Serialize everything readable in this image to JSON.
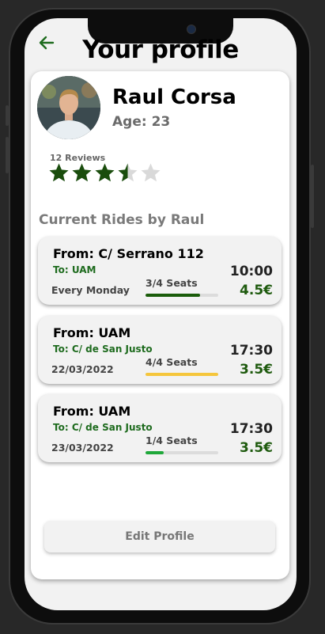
{
  "header": {
    "title": "Your profile",
    "back_icon": "arrow-left-icon",
    "accent_color": "#1e6b1e"
  },
  "profile": {
    "name": "Raul Corsa",
    "age_label": "Age: 23",
    "reviews_label": "12 Reviews",
    "rating": 3.5,
    "rating_max": 5,
    "star_color": "#1a4d0d",
    "star_empty_color": "#d9d9d9"
  },
  "rides_section": {
    "title": "Current Rides by Raul"
  },
  "rides": [
    {
      "from": "From: C/ Serrano 112",
      "to": "To: UAM",
      "date": "Every Monday",
      "seats": "3/4 Seats",
      "seats_fraction": 0.75,
      "bar_color": "#1a5c0a",
      "time": "10:00",
      "price": "4.5€"
    },
    {
      "from": "From: UAM",
      "to": "To: C/ de San Justo",
      "date": "22/03/2022",
      "seats": "4/4 Seats",
      "seats_fraction": 1.0,
      "bar_color": "#f5c63c",
      "time": "17:30",
      "price": "3.5€"
    },
    {
      "from": "From: UAM",
      "to": "To: C/ de San Justo",
      "date": "23/03/2022",
      "seats": "1/4 Seats",
      "seats_fraction": 0.25,
      "bar_color": "#1fa83a",
      "time": "17:30",
      "price": "3.5€"
    }
  ],
  "actions": {
    "edit_label": "Edit Profile"
  }
}
